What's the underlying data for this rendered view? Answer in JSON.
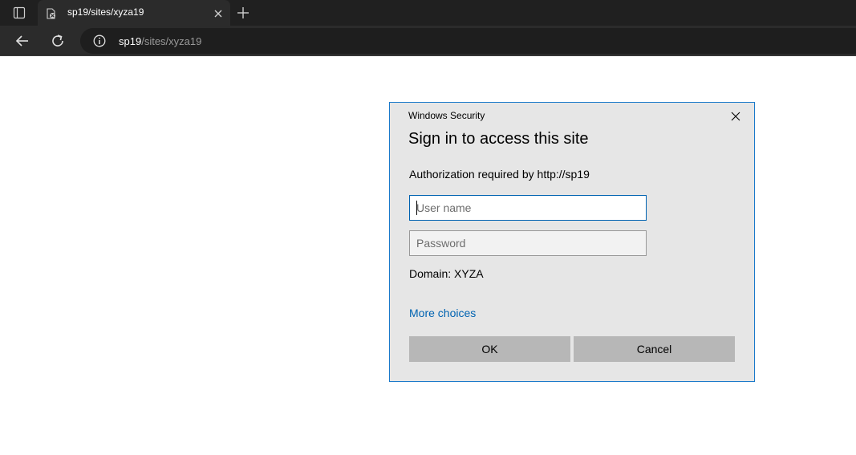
{
  "browser": {
    "tab": {
      "title": "sp19/sites/xyza19",
      "favicon": "document-blocked-icon"
    },
    "address": {
      "host": "sp19",
      "path": "/sites/xyza19"
    }
  },
  "dialog": {
    "caption": "Windows Security",
    "title": "Sign in to access this site",
    "auth_message": "Authorization required by http://sp19",
    "username_placeholder": "User name",
    "password_placeholder": "Password",
    "domain": "Domain: XYZA",
    "more_choices": "More choices",
    "ok_label": "OK",
    "cancel_label": "Cancel"
  },
  "colors": {
    "accent": "#0063b1",
    "dialog_border": "#1979ca",
    "dialog_bg": "#e6e6e6",
    "button_bg": "#b7b7b7",
    "browser_chrome": "#202020"
  }
}
